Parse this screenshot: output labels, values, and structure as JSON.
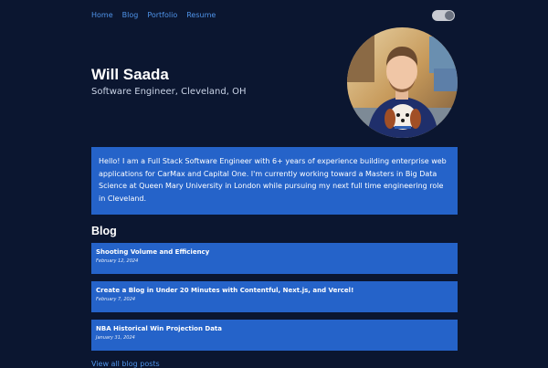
{
  "nav": {
    "items": [
      "Home",
      "Blog",
      "Portfolio",
      "Resume"
    ]
  },
  "theme_toggle": {
    "state": "on"
  },
  "hero": {
    "name": "Will Saada",
    "role": "Software Engineer, Cleveland, OH"
  },
  "bio": {
    "text": "Hello! I am a Full Stack Software Engineer with 6+ years of experience building enterprise web applications for CarMax and Capital One. I'm currently working toward a Masters in Big Data Science at Queen Mary University in London while pursuing my next full time engineering role in Cleveland."
  },
  "blog": {
    "heading": "Blog",
    "posts": [
      {
        "title": "Shooting Volume and Efficiency",
        "date": "February 12, 2024"
      },
      {
        "title": "Create a Blog in Under 20 Minutes with Contentful, Next.js, and Vercel!",
        "date": "February 7, 2024"
      },
      {
        "title": "NBA Historical Win Projection Data",
        "date": "January 31, 2024"
      }
    ],
    "view_all": "View all blog posts"
  },
  "colors": {
    "background": "#0b1630",
    "card": "#2563c9",
    "link": "#4f93e8"
  }
}
